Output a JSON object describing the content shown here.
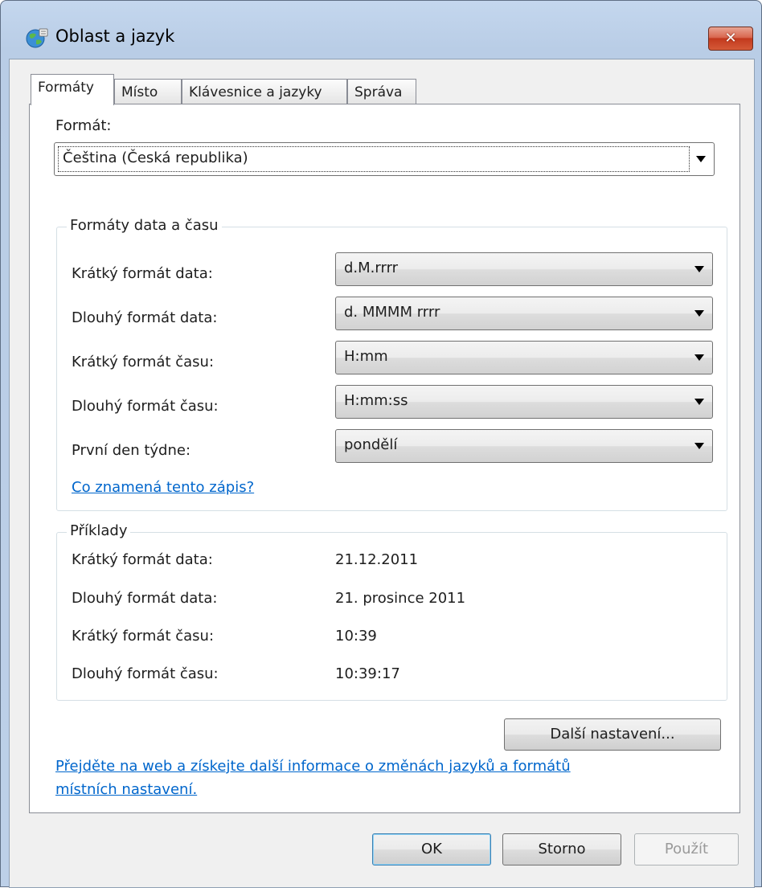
{
  "window": {
    "title": "Oblast a jazyk",
    "close_label": "✕"
  },
  "tabs": [
    {
      "label": "Formáty",
      "active": true
    },
    {
      "label": "Místo",
      "active": false
    },
    {
      "label": "Klávesnice a jazyky",
      "active": false
    },
    {
      "label": "Správa",
      "active": false
    }
  ],
  "format": {
    "label": "Formát:",
    "selected": "Čeština (Česká republika)"
  },
  "date_time_group": {
    "title": "Formáty data a času",
    "rows": [
      {
        "label": "Krátký formát data:",
        "value": "d.M.rrrr"
      },
      {
        "label": "Dlouhý formát data:",
        "value": "d. MMMM rrrr"
      },
      {
        "label": "Krátký formát času:",
        "value": "H:mm"
      },
      {
        "label": "Dlouhý formát času:",
        "value": "H:mm:ss"
      },
      {
        "label": "První den týdne:",
        "value": "pondělí"
      }
    ],
    "help_link": "Co znamená tento zápis?"
  },
  "examples_group": {
    "title": "Příklady",
    "rows": [
      {
        "label": "Krátký formát data:",
        "value": "21.12.2011"
      },
      {
        "label": "Dlouhý formát data:",
        "value": "21. prosince 2011"
      },
      {
        "label": "Krátký formát času:",
        "value": "10:39"
      },
      {
        "label": "Dlouhý formát času:",
        "value": "10:39:17"
      }
    ]
  },
  "more_settings_button": "Další nastavení...",
  "web_link_line1": "Přejděte na web a získejte další informace o změnách jazyků a formátů",
  "web_link_line2": "místních nastavení.",
  "buttons": {
    "ok": "OK",
    "cancel": "Storno",
    "apply": "Použít"
  },
  "colors": {
    "link": "#0066cc",
    "close_button": "#c2391d",
    "frame": "#bdd0e8"
  }
}
